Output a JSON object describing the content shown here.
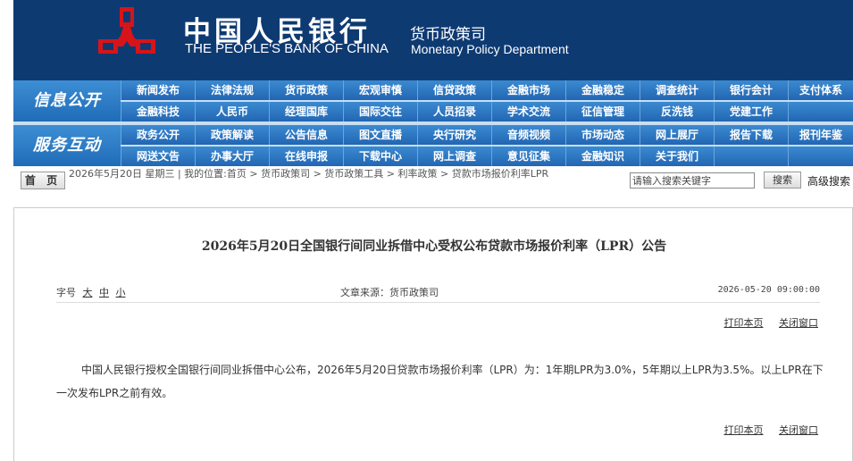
{
  "header": {
    "bank_name_cn": "中国人民银行",
    "bank_name_en": "THE PEOPLE'S BANK OF CHINA",
    "dept_cn": "货币政策司",
    "dept_en": "Monetary Policy Department",
    "brand_color": "#0e3a72",
    "logo_color": "#d7141a"
  },
  "nav": {
    "section1_title": "信息公开",
    "section2_title": "服务互动",
    "row1": [
      "新闻发布",
      "法律法规",
      "货币政策",
      "宏观审慎",
      "信贷政策",
      "金融市场",
      "金融稳定",
      "调查统计",
      "银行会计",
      "支付体系"
    ],
    "row2": [
      "金融科技",
      "人民币",
      "经理国库",
      "国际交往",
      "人员招录",
      "学术交流",
      "征信管理",
      "反洗钱",
      "党建工作"
    ],
    "row3": [
      "政务公开",
      "政策解读",
      "公告信息",
      "图文直播",
      "央行研究",
      "音频视频",
      "市场动态",
      "网上展厅",
      "报告下载",
      "报刊年鉴"
    ],
    "row4": [
      "网送文告",
      "办事大厅",
      "在线申报",
      "下载中心",
      "网上调查",
      "意见征集",
      "金融知识",
      "关于我们"
    ]
  },
  "breadcrumb": {
    "home_label": "首 页",
    "text": "2026年5月20日 星期三 | 我的位置:首页  >  货币政策司  >  货币政策工具  >  利率政策  >  贷款市场报价利率LPR",
    "search_placeholder": "请输入搜索关键字",
    "search_button": "搜索",
    "advanced_search": "高级搜索"
  },
  "article": {
    "title": "2026年5月20日全国银行间同业拆借中心受权公布贷款市场报价利率（LPR）公告",
    "font_size_label": "字号",
    "font_sizes": [
      "大",
      "中",
      "小"
    ],
    "source": "文章来源：货币政策司",
    "date": "2026-05-20 09:00:00",
    "print_label": "打印本页",
    "close_label": "关闭窗口",
    "body": "中国人民银行授权全国银行间同业拆借中心公布，2026年5月20日贷款市场报价利率（LPR）为：1年期LPR为3.0%，5年期以上LPR为3.5%。以上LPR在下一次发布LPR之前有效。"
  }
}
